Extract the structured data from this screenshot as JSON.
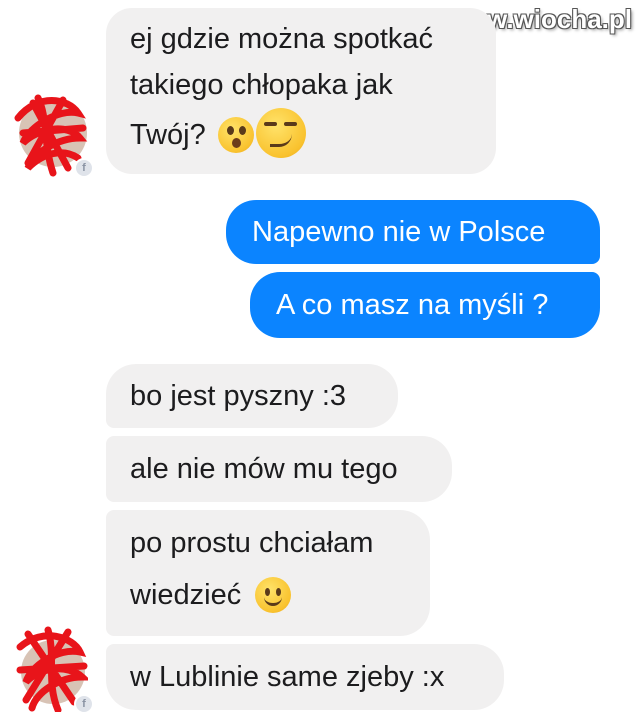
{
  "watermark": "www.wiocha.pl",
  "messages": [
    {
      "side": "in",
      "lines": [
        "ej gdzie można spotkać",
        "takiego chłopaka jak",
        "Twój?"
      ],
      "emoji": [
        "astonished-emoji",
        "smirk-emoji"
      ]
    },
    {
      "side": "out",
      "text": "Napewno nie w Polsce"
    },
    {
      "side": "out",
      "text": "A co masz na myśli ?"
    },
    {
      "side": "in",
      "text": "bo jest pyszny :3"
    },
    {
      "side": "in",
      "text": "ale nie mów mu tego"
    },
    {
      "side": "in",
      "lines": [
        "po prostu chciałam",
        "wiedzieć"
      ],
      "emoji": [
        "slight-smile-emoji"
      ]
    },
    {
      "side": "in",
      "text": "w Lublinie same zjeby :x"
    }
  ],
  "colors": {
    "incoming_bubble": "#f1f0f0",
    "outgoing_bubble": "#0b84ff",
    "scribble": "#e8141a"
  }
}
